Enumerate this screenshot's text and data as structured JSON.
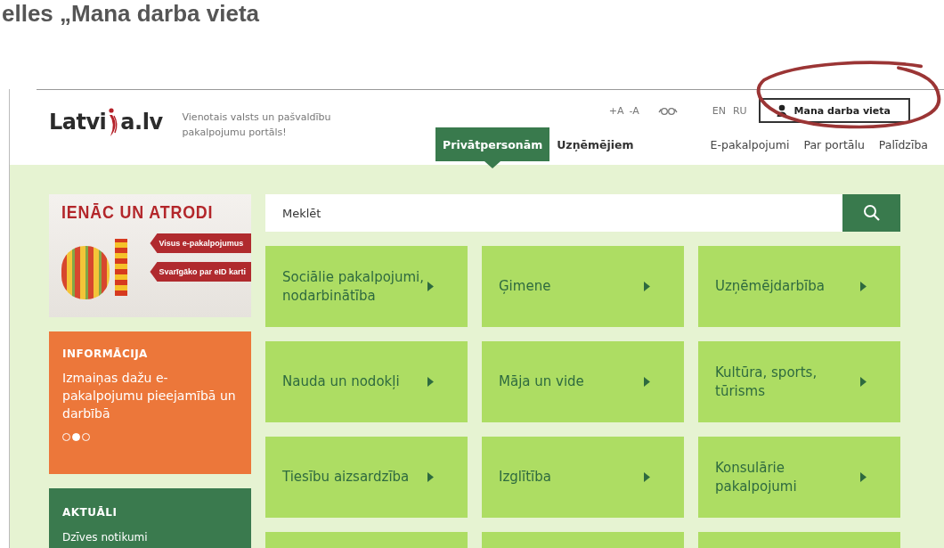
{
  "heading": "elles „Mana darba vieta",
  "header": {
    "logo_parts": [
      "Latvi",
      "a.lv"
    ],
    "tagline": "Vienotais valsts un pašvaldību pakalpojumu portāls!",
    "font_size_controls": [
      "+A",
      "-A"
    ],
    "languages": [
      {
        "label": "EN"
      },
      {
        "label": "RU"
      }
    ],
    "workplace_button": "Mana darba vieta",
    "nav": [
      {
        "label": "Privātpersonām",
        "kind": "audience",
        "selected": true
      },
      {
        "label": "Uzņēmējiem",
        "kind": "audience",
        "selected": false
      },
      {
        "label": "E-pakalpojumi",
        "kind": "link",
        "selected": false
      },
      {
        "label": "Par portālu",
        "kind": "link",
        "selected": false
      },
      {
        "label": "Palīdzība",
        "kind": "link",
        "selected": false
      }
    ]
  },
  "banner": {
    "title": "IENĀC UN ATRODI",
    "buttons": [
      "Visus e-pakalpojumus",
      "Svarīgāko par eID karti"
    ]
  },
  "info_card": {
    "heading": "INFORMĀCIJA",
    "text": "Izmaiņas dažu e-pakalpojumu pieejamībā un darbībā",
    "slides": [
      {
        "selected": false
      },
      {
        "selected": true
      },
      {
        "selected": false
      }
    ]
  },
  "news_card": {
    "heading": "AKTUĀLI",
    "items": [
      "Dzīves notikumi"
    ]
  },
  "search": {
    "placeholder": "Meklēt"
  },
  "tiles": [
    {
      "label": "Sociālie pakalpojumi, nodarbinātība"
    },
    {
      "label": "Ģimene"
    },
    {
      "label": "Uzņēmējdarbība"
    },
    {
      "label": "Nauda un nodokļi"
    },
    {
      "label": "Māja un vide"
    },
    {
      "label": "Kultūra, sports, tūrisms"
    },
    {
      "label": "Tiesību aizsardzība"
    },
    {
      "label": "Izglītība"
    },
    {
      "label": "Konsulārie pakalpojumi"
    }
  ],
  "more_rows_below": true,
  "annotation": {
    "highlight_workplace_button": true
  }
}
